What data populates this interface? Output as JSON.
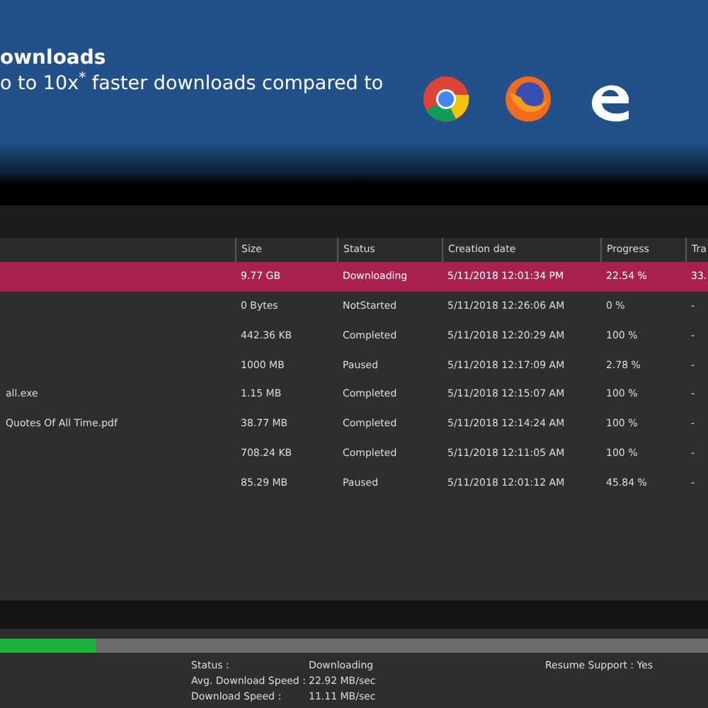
{
  "banner": {
    "title": "ownloads",
    "subtitle": "o to 10x$^{*}$ faster downloads compared to"
  },
  "table": {
    "columns": [
      "",
      "Size",
      "Status",
      "Creation date",
      "Progress",
      "Tra"
    ],
    "rows": [
      {
        "selected": true,
        "cells": [
          "",
          "9.77 GB",
          "Downloading",
          "5/11/2018 12:01:34 PM",
          "22.54 %",
          "33."
        ]
      },
      {
        "selected": false,
        "cells": [
          "",
          "0 Bytes",
          "NotStarted",
          "5/11/2018 12:26:06 AM",
          "0 %",
          "-"
        ]
      },
      {
        "selected": false,
        "cells": [
          "",
          "442.36 KB",
          "Completed",
          "5/11/2018 12:20:29 AM",
          "100 %",
          "-"
        ]
      },
      {
        "selected": false,
        "cells": [
          "",
          "1000 MB",
          "Paused",
          "5/11/2018 12:17:09 AM",
          "2.78 %",
          "-"
        ]
      },
      {
        "selected": false,
        "cells": [
          "all.exe",
          "1.15 MB",
          "Completed",
          "5/11/2018 12:15:07 AM",
          "100 %",
          "-"
        ]
      },
      {
        "selected": false,
        "cells": [
          "Quotes Of All Time.pdf",
          "38.77 MB",
          "Completed",
          "5/11/2018 12:14:24 AM",
          "100 %",
          "-"
        ]
      },
      {
        "selected": false,
        "cells": [
          "",
          "708.24 KB",
          "Completed",
          "5/11/2018 12:11:05 AM",
          "100 %",
          "-"
        ]
      },
      {
        "selected": false,
        "cells": [
          "",
          "85.29 MB",
          "Paused",
          "5/11/2018 12:01:12 AM",
          "45.84 %",
          "-"
        ]
      }
    ]
  },
  "progress": {
    "level": 0.135
  },
  "details": [
    {
      "label": "Status :",
      "value": "Downloading"
    },
    {
      "label": "Avg. Download Speed :",
      "value": "22.92 MB/sec"
    },
    {
      "label": "Download Speed :",
      "value": "11.11 MB/sec"
    }
  ],
  "resume": "Resume Support : Yes"
}
